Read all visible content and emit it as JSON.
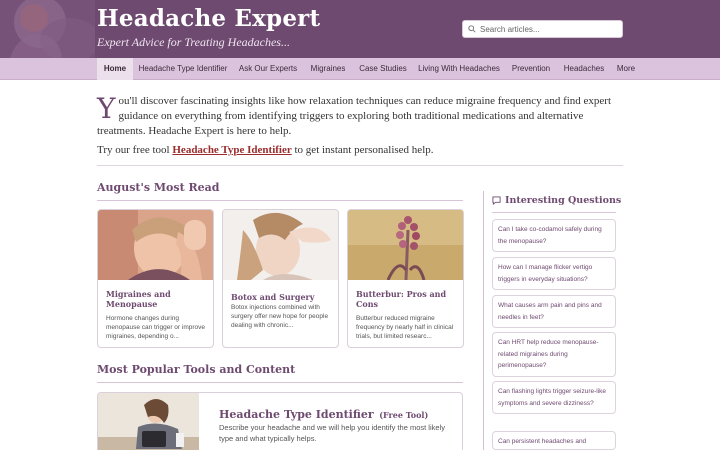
{
  "header": {
    "title": "Headache Expert",
    "tagline": "Expert Advice for Treating Headaches...",
    "search_placeholder": "Search articles..."
  },
  "nav": {
    "items": [
      {
        "label": "Home"
      },
      {
        "label": "Headache Type Identifier"
      },
      {
        "label": "Ask Our Experts"
      },
      {
        "label": "Migraines"
      },
      {
        "label": "Case Studies"
      },
      {
        "label": "Living With Headaches"
      },
      {
        "label": "Prevention"
      },
      {
        "label": "Headaches"
      },
      {
        "label": "More"
      }
    ],
    "active": "Home"
  },
  "intro": {
    "dropcap": "Y",
    "text": "ou'll discover fascinating insights like how relaxation techniques can reduce migraine frequency and find expert guidance on everything from identifying triggers to exploring both traditional medications and alternative treatments. Headache Expert is here to help.",
    "tool_prefix": "Try our free tool ",
    "tool_link": "Headache Type Identifier",
    "tool_suffix": " to get instant personalised help."
  },
  "most_read": {
    "heading": "August's Most Read",
    "cards": [
      {
        "title": "Migraines and Menopause",
        "text": "Hormone changes during menopause can trigger or improve migraines, depending o...",
        "image": "woman-holding-head-photo"
      },
      {
        "title": "Botox and Surgery",
        "text": "Botox injections combined with surgery offer new hope for people dealing with chronic...",
        "image": "woman-with-headache-photo"
      },
      {
        "title": "Butterbur: Pros and Cons",
        "text": "Butterbur reduced migraine frequency by nearly half in clinical trials, but limited researc...",
        "image": "butterbur-flower-photo"
      }
    ]
  },
  "popular": {
    "heading": "Most Popular Tools and Content",
    "tool": {
      "title": "Headache Type Identifier",
      "title_suffix": "(Free Tool)",
      "description": "Describe your headache and we will help you identify the most likely type and what typically helps.",
      "image": "woman-with-tablet-photo"
    }
  },
  "sidebar": {
    "heading": "Interesting Questions",
    "icon": "chat-bubble-icon",
    "questions": [
      {
        "text": "Can I take co-codamol safely during the menopause?"
      },
      {
        "text": "How can I manage flicker vertigo triggers in everyday situations?"
      },
      {
        "text": "What causes arm pain and pins and needles in feet?"
      },
      {
        "text": "Can HRT help reduce menopause-related migraines during perimenopause?"
      },
      {
        "text": "Can flashing lights trigger seizure-like symptoms and severe dizziness?"
      },
      {
        "text": "Can persistent headaches and"
      }
    ]
  },
  "colors": {
    "brand": "#6e4a70",
    "nav_bg": "#dcc3dd",
    "link": "#9a2c2c"
  }
}
